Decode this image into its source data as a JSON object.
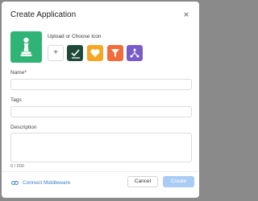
{
  "dialog": {
    "title": "Create Application",
    "close_symbol": "×"
  },
  "icon_picker": {
    "label": "Upload or Choose Icon",
    "add_symbol": "+",
    "selected_icon": {
      "name": "chess-pawn-icon",
      "color": "#2fb476"
    },
    "options": [
      {
        "name": "checklist-icon",
        "color": "#1f4a3a"
      },
      {
        "name": "heart-icon",
        "color": "#f5a623"
      },
      {
        "name": "funnel-icon",
        "color": "#f26b3a"
      },
      {
        "name": "network-icon",
        "color": "#7a5bc7"
      }
    ]
  },
  "form": {
    "name_label": "Name*",
    "name_value": "",
    "tags_label": "Tags",
    "tags_value": "",
    "description_label": "Description",
    "description_value": "",
    "description_counter": "0 / 200"
  },
  "footer": {
    "connect_label": "Connect Middleware",
    "cancel_label": "Cancel",
    "create_label": "Create"
  },
  "colors": {
    "link": "#3b7ec8",
    "primary_disabled": "#a9ccf4"
  }
}
